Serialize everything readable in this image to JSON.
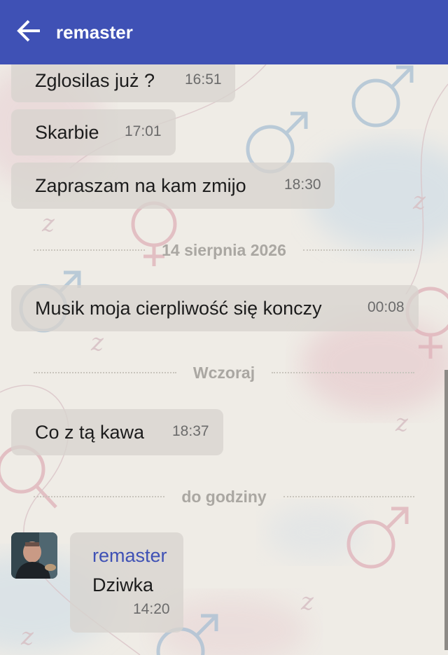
{
  "header": {
    "title": "remaster",
    "back_icon": "arrow-left-icon",
    "color": "#3f51b5"
  },
  "messages": [
    {
      "text": "Zglosilas już ?",
      "time": "16:51"
    },
    {
      "text": "Skarbie",
      "time": "17:01"
    },
    {
      "text": "Zapraszam na kam zmijo",
      "time": "18:30"
    },
    {
      "text": "Musik moja cierpliwość się konczy",
      "time": "00:08"
    },
    {
      "text": "Co z tą kawa",
      "time": "18:37"
    }
  ],
  "separators": [
    "14 sierpnia 2026",
    "Wczoraj",
    "do godziny"
  ],
  "incoming": {
    "sender": "remaster",
    "text": "Dziwka",
    "time": "14:20",
    "sender_color": "#3f51b5"
  }
}
